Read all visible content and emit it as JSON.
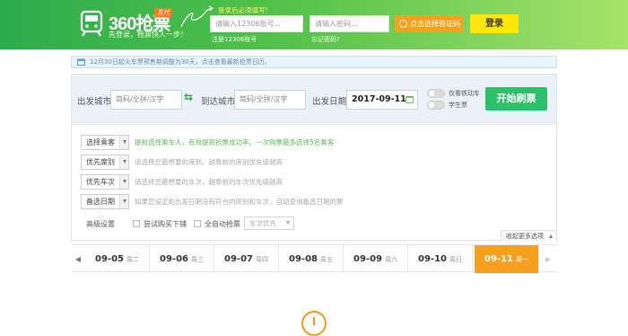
{
  "header": {
    "brand": "360抢票",
    "badge": "五代",
    "slogan": "先登录，抢票快人一步！",
    "login_tip": "登录后必须填写!",
    "username_placeholder": "请输入12306账号...",
    "password_placeholder": "请输入密码...",
    "register_link": "注册12306账号",
    "forgot_link": "忘记密码?",
    "verify_label": "点击选择验证码",
    "login_label": "登录"
  },
  "notice": {
    "text": "12月30日起火车票预售期调整为30天，点击查看最新抢票日历。"
  },
  "search": {
    "from_label": "出发城市",
    "from_placeholder": "简码/全拼/汉字",
    "to_label": "到达城市",
    "to_placeholder": "简码/全拼/汉字",
    "date_label": "出发日期",
    "date_value": "2017-09-11",
    "toggle_gaotie": "仅看铁动车",
    "toggle_student": "学生票",
    "start_label": "开始刷票"
  },
  "options": {
    "rows": [
      {
        "button": "选择乘客",
        "text": "提前选择乘车人，有效提高抢票成功率。一次购票最多选择5名乘客"
      },
      {
        "button": "优先席别",
        "text": "请选择您最想要的席别，越靠前的席别优先级越高"
      },
      {
        "button": "优先车次",
        "text": "请选择您最想要的车次，越靠前的车次优先级越高"
      },
      {
        "button": "备选日期",
        "text": "如果您设定的出发日期没有符合的席别和车次，自动查询备选日期的票"
      }
    ],
    "advanced_label": "高级设置",
    "try_buy_label": "尝试购买下铺",
    "auto_grab_label": "全自动抢票",
    "priority_placeholder": "车次优先",
    "more_label": "收起更多选项"
  },
  "dates": [
    {
      "date": "09-05",
      "weekday": "周二"
    },
    {
      "date": "09-06",
      "weekday": "周三"
    },
    {
      "date": "09-07",
      "weekday": "周四"
    },
    {
      "date": "09-08",
      "weekday": "周五"
    },
    {
      "date": "09-09",
      "weekday": "周六"
    },
    {
      "date": "09-10",
      "weekday": "周日"
    },
    {
      "date": "09-11",
      "weekday": "周一"
    }
  ],
  "colors": {
    "header_start": "#2cab4c",
    "header_end": "#a7e26a",
    "primary_green": "#2dc06a",
    "accent_orange": "#f7a01f",
    "login_yellow": "#ffe70d"
  },
  "icons": {
    "logo": "train-icon",
    "notice": "calendar-icon",
    "swap": "swap-icon",
    "date": "calendar-icon",
    "alert": "alert-icon"
  }
}
